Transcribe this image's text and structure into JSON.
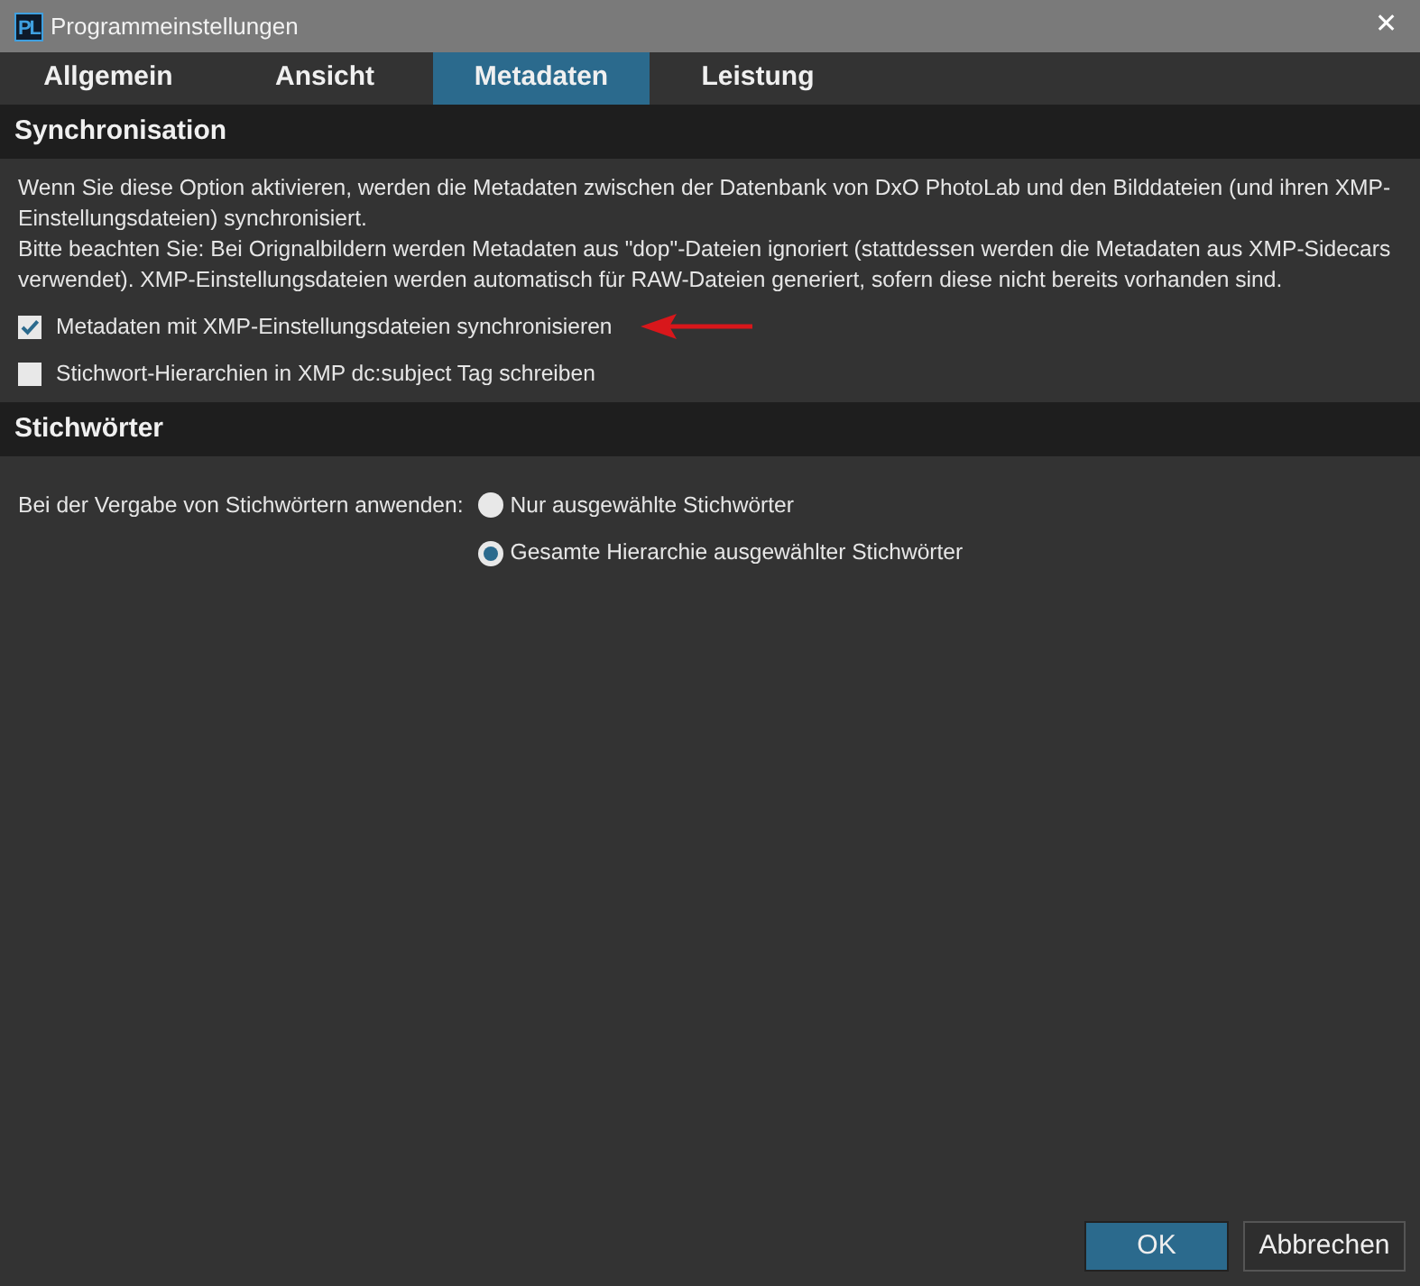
{
  "window": {
    "title": "Programmeinstellungen",
    "app_icon": "PL",
    "close": "✕"
  },
  "tabs": [
    {
      "label": "Allgemein",
      "selected": false
    },
    {
      "label": "Ansicht",
      "selected": false
    },
    {
      "label": "Metadaten",
      "selected": true
    },
    {
      "label": "Leistung",
      "selected": false
    }
  ],
  "sections": [
    {
      "title": "Synchronisation",
      "paragraphs": [
        "Wenn Sie diese Option aktivieren, werden die Metadaten zwischen der Datenbank von DxO PhotoLab und den Bilddateien (und ihren XMP-Einstellungsdateien) synchronisiert.",
        "Bitte beachten Sie: Bei Orignalbildern werden Metadaten aus \"dop\"-Dateien ignoriert (stattdessen werden die Metadaten aus XMP-Sidecars verwendet). XMP-Einstellungsdateien werden automatisch für RAW-Dateien generiert, sofern diese nicht bereits vorhanden sind."
      ],
      "checkboxes": [
        {
          "label": "Metadaten mit XMP-Einstellungsdateien synchronisieren",
          "checked": true,
          "annotated": true
        },
        {
          "label": "Stichwort-Hierarchien in XMP dc:subject Tag schreiben",
          "checked": false,
          "annotated": false
        }
      ]
    },
    {
      "title": "Stichwörter",
      "radio_label": "Bei der Vergabe von Stichwörtern anwenden:",
      "radios": [
        {
          "label": "Nur ausgewählte Stichwörter",
          "selected": false
        },
        {
          "label": "Gesamte Hierarchie ausgewählter Stichwörter",
          "selected": true
        }
      ]
    }
  ],
  "buttons": [
    {
      "label": "OK",
      "kind": "primary"
    },
    {
      "label": "Abbrechen",
      "kind": "secondary"
    }
  ]
}
